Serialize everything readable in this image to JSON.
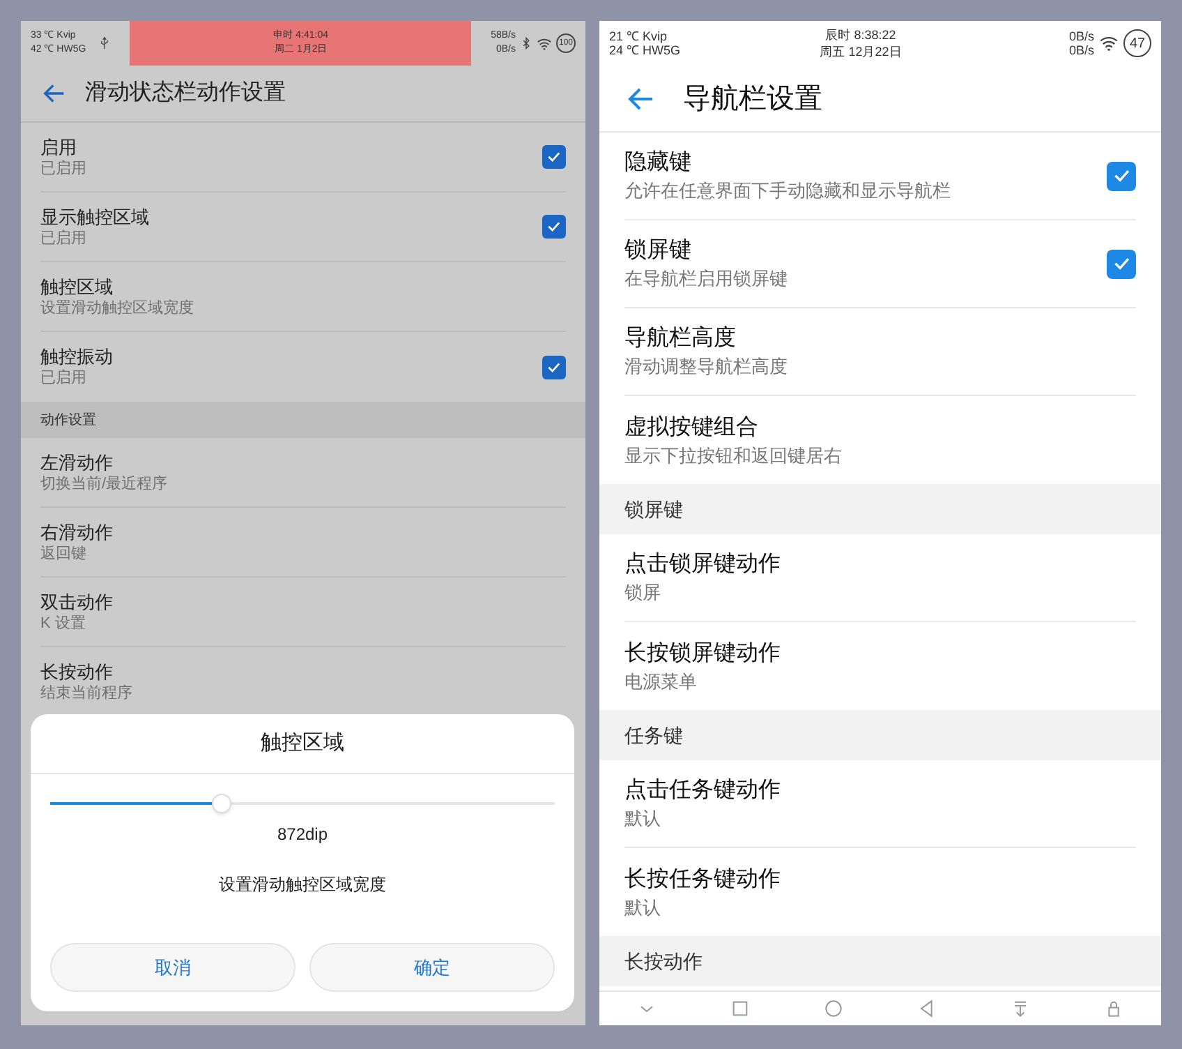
{
  "left_screen": {
    "status_bar": {
      "weather": [
        "33 ℃ Kvip",
        "42 ℃ HW5G"
      ],
      "clock": [
        "申时 4:41:04",
        "周二 1月2日"
      ],
      "speeds": [
        "58B/s",
        "0B/s"
      ],
      "battery": "100",
      "left_icons": [
        {
          "kind": "usb"
        }
      ],
      "right_icons": [
        {
          "kind": "bluetooth"
        },
        {
          "kind": "wifi"
        }
      ]
    },
    "header": {
      "title": "滑动状态栏动作设置"
    },
    "sections": [
      {
        "rows": [
          {
            "title": "启用",
            "summary": "已启用",
            "checked": true
          },
          {
            "title": "显示触控区域",
            "summary": "已启用",
            "checked": true
          },
          {
            "title": "触控区域",
            "summary": "设置滑动触控区域宽度"
          },
          {
            "title": "触控振动",
            "summary": "已启用",
            "checked": true
          }
        ]
      },
      {
        "header": "动作设置",
        "rows": [
          {
            "title": "左滑动作",
            "summary": "切换当前/最近程序"
          },
          {
            "title": "右滑动作",
            "summary": "返回键"
          },
          {
            "title": "双击动作",
            "summary": "K 设置"
          },
          {
            "title": "长按动作",
            "summary": "结束当前程序"
          }
        ]
      }
    ],
    "dialog": {
      "title": "触控区域",
      "slider": {
        "level": 0.34
      },
      "value": "872dip",
      "message": "设置滑动触控区域宽度",
      "buttons": [
        "取消",
        "确定"
      ]
    }
  },
  "right_screen": {
    "status_bar": {
      "weather": [
        "21 ℃ Kvip",
        "24 ℃ HW5G"
      ],
      "clock": [
        "辰时 8:38:22",
        "周五 12月22日"
      ],
      "speeds": [
        "0B/s",
        "0B/s"
      ],
      "battery": "47",
      "right_icons": [
        {
          "kind": "wifi"
        }
      ]
    },
    "header": {
      "title": "导航栏设置"
    },
    "sections": [
      {
        "rows": [
          {
            "title": "隐藏键",
            "summary": "允许在任意界面下手动隐藏和显示导航栏",
            "checked": true
          },
          {
            "title": "锁屏键",
            "summary": "在导航栏启用锁屏键",
            "checked": true
          },
          {
            "title": "导航栏高度",
            "summary": "滑动调整导航栏高度"
          },
          {
            "title": "虚拟按键组合",
            "summary": "显示下拉按钮和返回键居右"
          }
        ]
      },
      {
        "header": "锁屏键",
        "rows": [
          {
            "title": "点击锁屏键动作",
            "summary": "锁屏"
          },
          {
            "title": "长按锁屏键动作",
            "summary": "电源菜单"
          }
        ]
      },
      {
        "header": "任务键",
        "rows": [
          {
            "title": "点击任务键动作",
            "summary": "默认"
          },
          {
            "title": "长按任务键动作",
            "summary": "默认"
          }
        ]
      },
      {
        "header": "长按动作"
      }
    ]
  }
}
